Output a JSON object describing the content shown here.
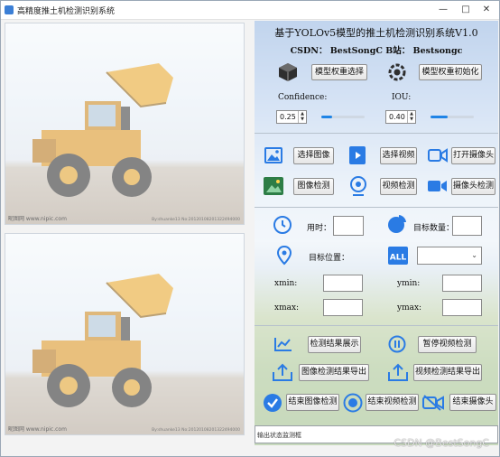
{
  "window": {
    "title": "高精度推土机检测识别系统",
    "controls": [
      "—",
      "□",
      "✕"
    ]
  },
  "panes": {
    "watermark_left": "昵图网 www.nipic.com",
    "watermark_right": "By:shuanke13 No:20120108201322494000"
  },
  "header": {
    "title": "基于YOLOv5模型的推土机检测识别系统V1.0",
    "subtitle": "CSDN：  BestSongC   B站：  Bestsongc"
  },
  "model": {
    "select_label": "模型权重选择",
    "init_label": "模型权重初始化"
  },
  "params": {
    "confidence_label": "Confidence:",
    "confidence_value": "0.25",
    "confidence_slider": 0.25,
    "iou_label": "IOU:",
    "iou_value": "0.40",
    "iou_slider": 0.4
  },
  "actions": {
    "select_image": "选择图像",
    "select_video": "选择视频",
    "open_camera": "打开摄像头",
    "image_detect": "图像检测",
    "video_detect": "视频检测",
    "camera_detect": "摄像头检测"
  },
  "results": {
    "time_label": "用时：",
    "count_label": "目标数量：",
    "position_label": "目标位置：",
    "xmin_label": "xmin:",
    "ymin_label": "ymin:",
    "xmax_label": "xmax:",
    "ymax_label": "ymax:"
  },
  "bottom": {
    "show_results": "检测结果展示",
    "pause_video": "暂停视频检测",
    "export_image": "图像检测结果导出",
    "export_video": "视频检测结果导出",
    "end_image": "结束图像检测",
    "end_video": "结束视频检测",
    "end_camera": "结束摄像头"
  },
  "status": {
    "placeholder": "输出状态监测框"
  },
  "watermark": "CSDN @BestSongC",
  "colors": {
    "accent": "#1f84e6",
    "icon_blue": "#2a7be4"
  }
}
